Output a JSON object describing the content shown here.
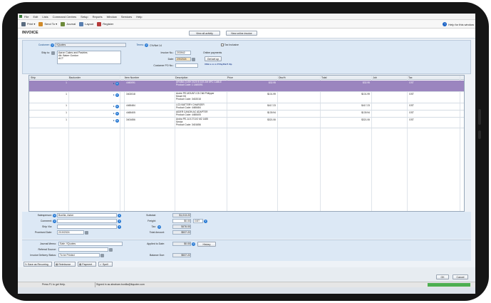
{
  "menu": [
    "File",
    "Edit",
    "Lists",
    "Command Centres",
    "Setup",
    "Reports",
    "Window",
    "Services",
    "Help"
  ],
  "toolbar": {
    "print": "Print",
    "send_to": "Send To",
    "journal": "Journal",
    "layout": "Layout",
    "register": "Register",
    "help": "Help for this window"
  },
  "page": {
    "title": "INVOICE",
    "view_activity": "View all activity",
    "new_online": "New online invoice"
  },
  "header": {
    "customer_label": "Customer:",
    "customer_value": "!!Quotes",
    "terms_label": "Terms:",
    "terms_value": "C%/Net 14",
    "tax_inclusive": "Tax Inclusive",
    "ship_to_label": "Ship to:",
    "ship_to_lines": [
      "Aaron Cakes and Pastries",
      "Att: Baker Gordon",
      "ACT"
    ],
    "invoice_no_label": "Invoice No.:",
    "invoice_no": "203942",
    "date_label": "Date:",
    "date": "2/9/2024",
    "online_payments": "Online payments",
    "get_set_up": "Get set up",
    "customer_po_label": "Customer PO No.:"
  },
  "grid": {
    "columns": [
      "Ship",
      "Backorder",
      "Item Number",
      "Description",
      "Price",
      "Disc%",
      "Total",
      "Job",
      "Tax"
    ],
    "rows": [
      {
        "ship": "1",
        "item": "4460091",
        "desc": [
          "ARUBA CUSH 2020 B 10S 2M 8PC CABLE",
          "Product Code: 1 1460091"
        ],
        "price": "$32.95",
        "total": "$32.95",
        "tax": "GST",
        "selected": true
      },
      {
        "ship": "1",
        "item": "3402018",
        "desc": [
          "Arobe PE-MOUNT-C8 Chili Philipper",
          "Mount Kit",
          "Product Code: 3402018"
        ],
        "price": "$101.99",
        "total": "$101.99",
        "tax": "GST",
        "selected": false
      },
      {
        "ship": "1",
        "item": "4465484",
        "desc": [
          "LCD BATTERY CHARGER",
          "Product Code: 4465484"
        ],
        "price": "$417.23",
        "total": "$417.23",
        "tax": "GST",
        "selected": false
      },
      {
        "ship": "1",
        "item": "4465405",
        "desc": [
          "AIDER CANON AC ADAPTER",
          "Product Code: 4465405"
        ],
        "price": "$139.94",
        "total": "$139.94",
        "tax": "GST",
        "selected": false
      },
      {
        "ship": "1",
        "item": "3401656",
        "desc": [
          "Aroba PE-1L5 271X2 M2 1485",
          "Senior",
          "Product Code: 3401656"
        ],
        "price": "$321.06",
        "total": "$321.06",
        "tax": "GST",
        "selected": false
      }
    ]
  },
  "mid": {
    "salesperson_label": "Salesperson:",
    "salesperson": "Bonilla, Asher",
    "comment_label": "Comment:",
    "ship_via_label": "Ship Via:",
    "promised_label": "Promised Date:",
    "promised": "2/19/2024",
    "subtotal_label": "Subtotal:",
    "subtotal": "$1,013.22",
    "freight_label": "Freight:",
    "freight": "$0.00",
    "freight_tax": "GST",
    "tax_label": "Tax:",
    "tax": "$476.00",
    "total_label": "Total Amount:",
    "total": "$537.22"
  },
  "foot": {
    "journal_label": "Journal Memo:",
    "journal": "Sale; !!Quotes",
    "referral_label": "Referral Source:",
    "delivery_label": "Invoice Delivery Status:",
    "delivery": "To be Printed",
    "applied_label": "Applied to Date:",
    "applied": "$0.00",
    "history": "History",
    "balance_label": "Balance Due:",
    "balance": "$537.22"
  },
  "actions": [
    "Save as Recurring",
    "Reimburse",
    "Payment",
    "Spell"
  ],
  "buttons": {
    "ok": "OK",
    "cancel": "Cancel"
  },
  "status": {
    "left": "Press F1 to get Help.",
    "right": "Signed in as abraham.bonilla@itquoter.com"
  },
  "colors": {
    "selected_row": "#9b85bf",
    "header_bg": "#dce8f5",
    "accent": "#2a7bd4"
  }
}
